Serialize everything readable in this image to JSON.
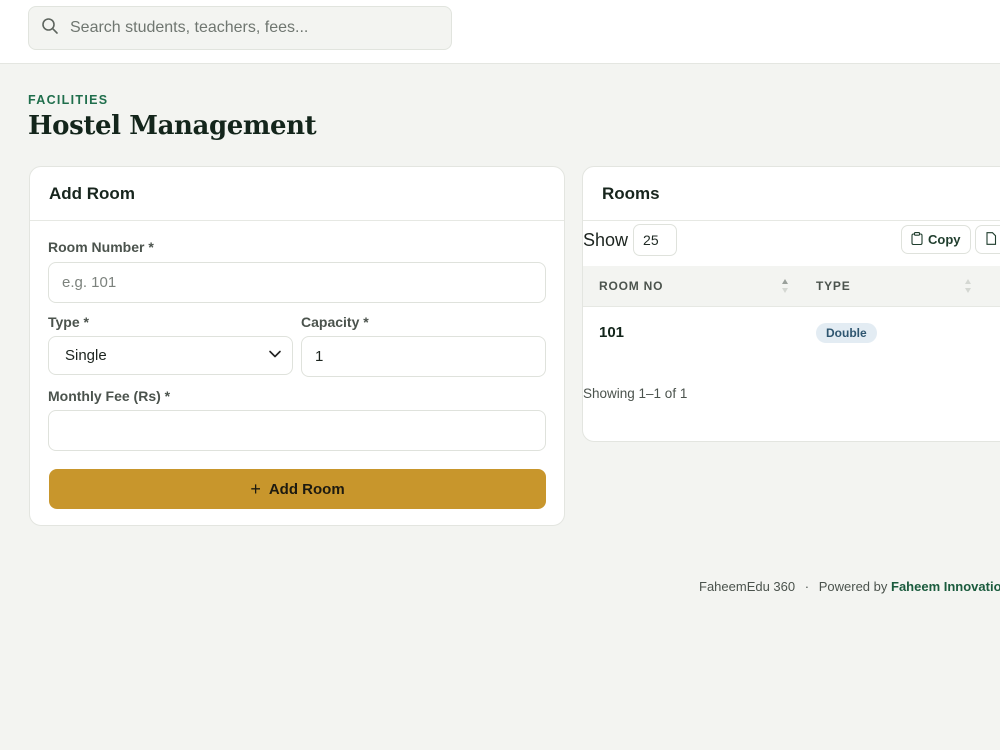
{
  "search": {
    "placeholder": "Search students, teachers, fees..."
  },
  "page": {
    "eyebrow": "FACILITIES",
    "title": "Hostel Management"
  },
  "add_room": {
    "title": "Add Room",
    "room_number": {
      "label": "Room Number *",
      "placeholder": "e.g. 101",
      "value": ""
    },
    "type": {
      "label": "Type *",
      "value": "Single"
    },
    "capacity": {
      "label": "Capacity *",
      "value": "1"
    },
    "monthly_fee": {
      "label": "Monthly Fee (Rs) *",
      "value": ""
    },
    "submit_label": "Add Room"
  },
  "rooms": {
    "title": "Rooms",
    "show_label": "Show",
    "page_size": "25",
    "copy_label": "Copy",
    "columns": [
      "ROOM NO",
      "TYPE"
    ],
    "rows": [
      {
        "room_no": "101",
        "type": "Double"
      }
    ],
    "showing_text": "Showing 1–1 of 1"
  },
  "footer": {
    "app": "FaheemEdu 360",
    "separator": "·",
    "powered_by": "Powered by",
    "company": "Faheem Innovations"
  },
  "colors": {
    "accent": "#c8962c",
    "brand_green": "#1f6e4c",
    "background": "#f3f4f1"
  }
}
